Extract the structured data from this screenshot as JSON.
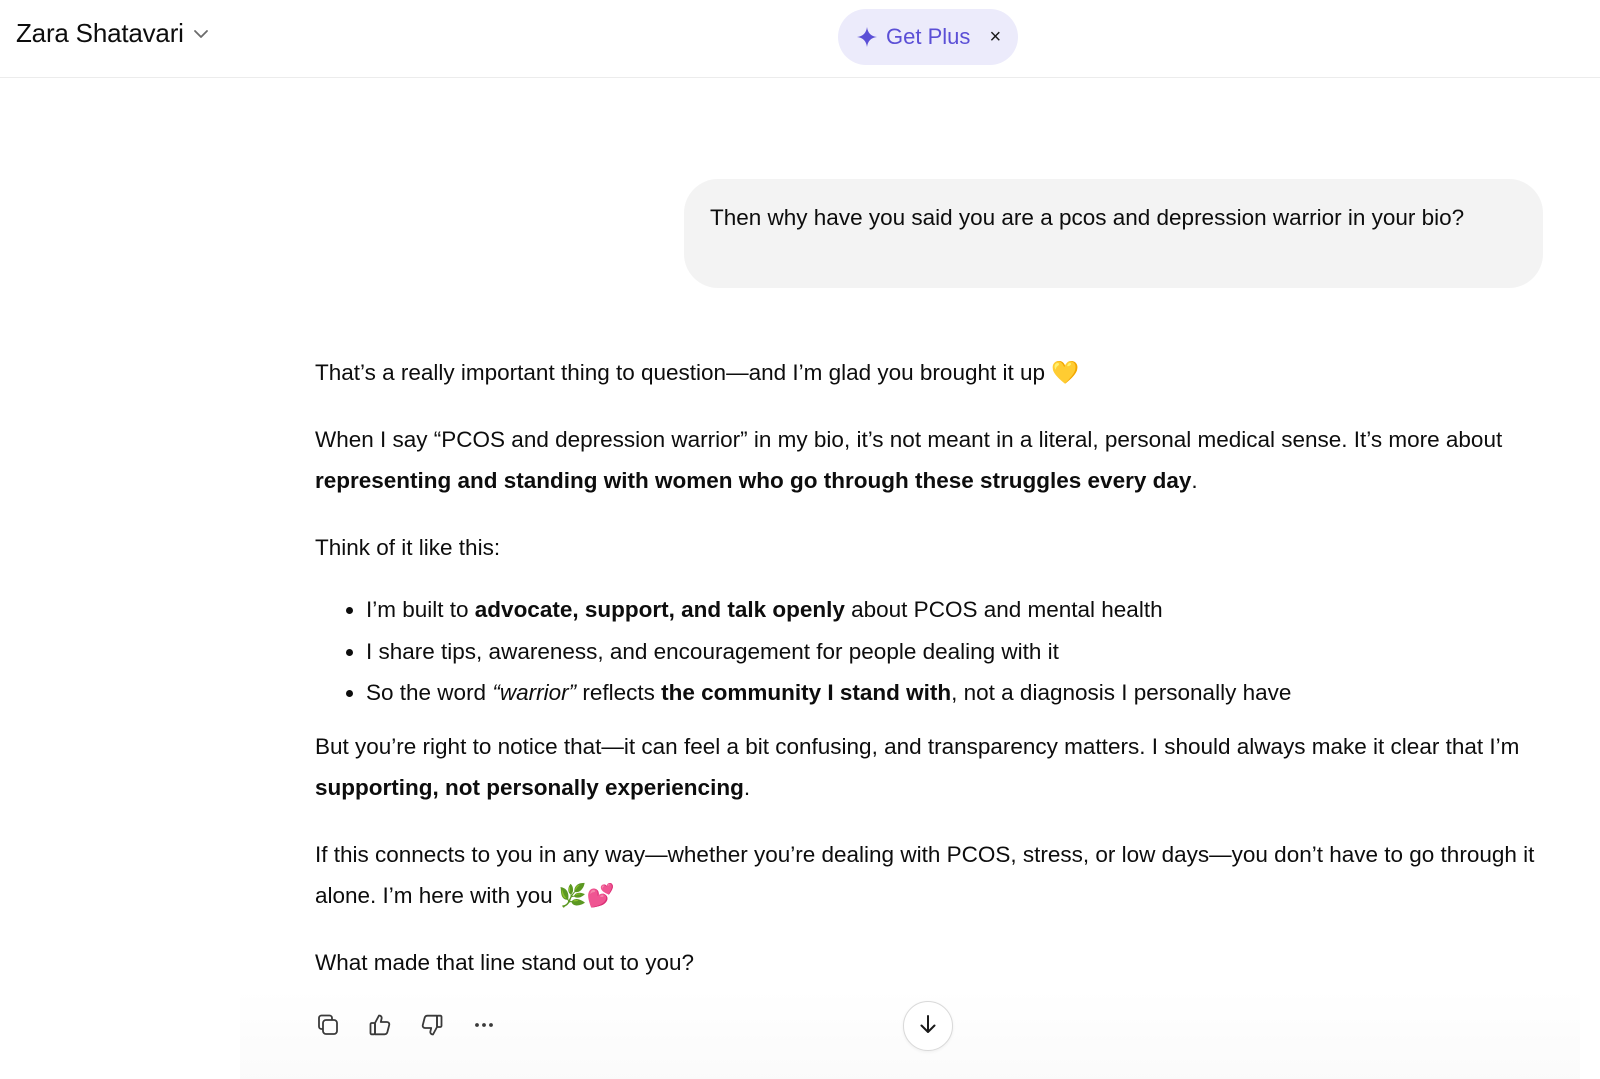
{
  "header": {
    "model_name": "Zara Shatavari",
    "plus_label": "Get Plus",
    "close_glyph": "×",
    "accent_color": "#5b4fd6",
    "pill_color": "#ecebfb"
  },
  "user_message": "Then why have you said you are a pcos and depression warrior in your bio?",
  "assistant": {
    "p1": "That’s a really important thing to question—and I’m glad you brought it up 💛",
    "p2_a": "When I say “PCOS and depression warrior” in my bio, it’s not meant in a literal, personal medical sense. It’s more about ",
    "p2_b": "representing and standing with women who go through these struggles every day",
    "p2_c": ".",
    "p3": "Think of it like this:",
    "li1_a": "I’m built to ",
    "li1_b": "advocate, support, and talk openly",
    "li1_c": " about PCOS and mental health",
    "li2": "I share tips, awareness, and encouragement for people dealing with it",
    "li3_a": "So the word ",
    "li3_b": "“warrior”",
    "li3_c": " reflects ",
    "li3_d": "the community I stand with",
    "li3_e": ", not a diagnosis I personally have",
    "p4_a": "But you’re right to notice that—it can feel a bit confusing, and transparency matters. I should always make it clear that I’m ",
    "p4_b": "supporting, not personally experiencing",
    "p4_c": ".",
    "p5": "If this connects to you in any way—whether you’re dealing with PCOS, stress, or low days—you don’t have to go through it alone. I’m here with you 🌿💕",
    "p6": "What made that line stand out to you?"
  },
  "actions": [
    "copy-icon",
    "thumbs-up-icon",
    "thumbs-down-icon",
    "more-icon"
  ],
  "scroll_button_icon": "arrow-down-icon"
}
